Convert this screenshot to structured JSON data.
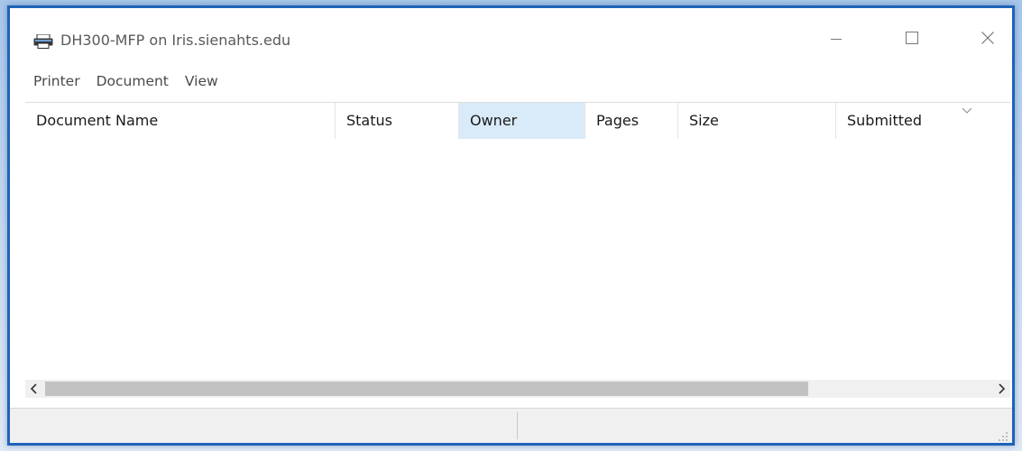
{
  "window": {
    "title": "DH300-MFP on Iris.sienahts.edu",
    "app_icon": "printer-icon",
    "controls": {
      "minimize_icon": "minimize-icon",
      "maximize_icon": "maximize-icon",
      "close_icon": "close-icon"
    }
  },
  "menu": {
    "items": [
      {
        "label": "Printer"
      },
      {
        "label": "Document"
      },
      {
        "label": "View"
      }
    ]
  },
  "list": {
    "columns": [
      {
        "label": "Document Name",
        "selected": false
      },
      {
        "label": "Status",
        "selected": false
      },
      {
        "label": "Owner",
        "selected": true
      },
      {
        "label": "Pages",
        "selected": false
      },
      {
        "label": "Size",
        "selected": false
      },
      {
        "label": "Submitted",
        "selected": false,
        "sort_icon": "chevron-down-icon"
      }
    ],
    "rows": []
  },
  "scrollbar": {
    "left_icon": "chevron-left-icon",
    "right_icon": "chevron-right-icon"
  },
  "status": {
    "left_text": "",
    "right_text": "",
    "grip_icon": "resize-grip-icon"
  },
  "colors": {
    "window_border": "#1f63b8",
    "selected_column": "#d9ebf9",
    "scroll_thumb": "#c2c2c2"
  }
}
